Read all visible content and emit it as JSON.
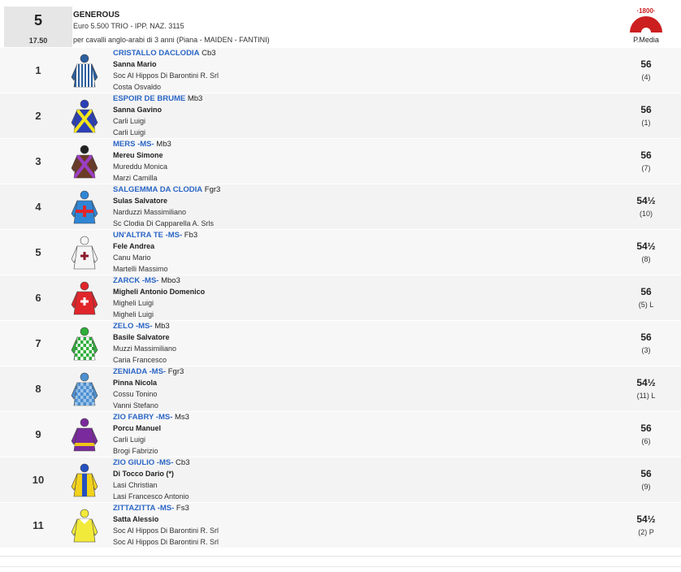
{
  "race": {
    "number": "5",
    "time": "17.50",
    "name": "GENEROUS",
    "prize": "Euro 5.500 TRIO - IPP. NAZ. 3115",
    "conditions": "per cavalli anglo-arabi di 3 anni (Piana -  MAIDEN  - FANTINI)",
    "logo_text": "·1800·",
    "pmedia_label": "P.Media"
  },
  "colors": {
    "horse_name": "#2b66c6",
    "row_bg": "#f7f7f7",
    "race_box_bg": "#e6e6e6",
    "logo_red": "#cc1f1f"
  },
  "runners": [
    {
      "num": "1",
      "horse": "CRISTALLO DACLODIA",
      "suffix": " Cb3",
      "jockey": "Sanna Mario",
      "trainer": "Soc Al Hippos Di Barontini R. Srl",
      "owner": "Costa Osvaldo",
      "weight": "56",
      "draw": "(4)",
      "silk": "blue-white-stripes",
      "silk_body": "#2c5f9e",
      "silk_alt": "#ffffff",
      "silk_cap": "#2c5f9e"
    },
    {
      "num": "2",
      "horse": "ESPOIR DE BRUME",
      "suffix": " Mb3",
      "jockey": "Sanna Gavino",
      "trainer": "Carli Luigi",
      "owner": "Carli Luigi",
      "weight": "56",
      "draw": "(1)",
      "silk": "blue-yellow-cross",
      "silk_body": "#2b3fb8",
      "silk_alt": "#f2e41c",
      "silk_cap": "#2b3fb8"
    },
    {
      "num": "3",
      "horse": "MERS -MS-",
      "suffix": " Mb3",
      "jockey": "Mereu Simone",
      "trainer": "Mureddu Monica",
      "owner": "Marzi Camilla",
      "weight": "56",
      "draw": "(7)",
      "silk": "brown-purple-cross",
      "silk_body": "#6b3b26",
      "silk_alt": "#9b3fc4",
      "silk_cap": "#222222"
    },
    {
      "num": "4",
      "horse": "SALGEMMA DA CLODIA",
      "suffix": " Fgr3",
      "jockey": "Sulas Salvatore",
      "trainer": "Narduzzi Massimiliano",
      "owner": "Sc Clodia Di Capparella A. Srls",
      "weight": "54½",
      "draw": "(10)",
      "silk": "lightblue-red-cross",
      "silk_body": "#2f86d6",
      "silk_alt": "#e0262b",
      "silk_cap": "#2f86d6"
    },
    {
      "num": "5",
      "horse": "UN'ALTRA TE -MS-",
      "suffix": " Fb3",
      "jockey": "Fele Andrea",
      "trainer": "Canu Mario",
      "owner": "Martelli Massimo",
      "weight": "54½",
      "draw": "(8)",
      "silk": "white-maroon-cross",
      "silk_body": "#f5f5f5",
      "silk_alt": "#8a1c2b",
      "silk_cap": "#f5f5f5"
    },
    {
      "num": "6",
      "horse": "ZARCK -MS-",
      "suffix": " Mbo3",
      "jockey": "Migheli Antonio Domenico",
      "trainer": "Migheli Luigi",
      "owner": "Migheli Luigi",
      "weight": "56",
      "draw": "(5) L",
      "silk": "red-white-cross",
      "silk_body": "#e0262b",
      "silk_alt": "#ffffff",
      "silk_cap": "#e0262b"
    },
    {
      "num": "7",
      "horse": "ZELO -MS-",
      "suffix": " Mb3",
      "jockey": "Basile Salvatore",
      "trainer": "Muzzi Massimiliano",
      "owner": "Caria Francesco",
      "weight": "56",
      "draw": "(3)",
      "silk": "green-check",
      "silk_body": "#2fae3a",
      "silk_alt": "#ffffff",
      "silk_cap": "#2fae3a"
    },
    {
      "num": "8",
      "horse": "ZENIADA -MS-",
      "suffix": " Fgr3",
      "jockey": "Pinna Nicola",
      "trainer": "Cossu Tonino",
      "owner": "Vanni Stefano",
      "weight": "54½",
      "draw": "(11) L",
      "silk": "lightblue-check",
      "silk_body": "#4d8fd0",
      "silk_alt": "#9cc4ea",
      "silk_cap": "#4d8fd0"
    },
    {
      "num": "9",
      "horse": "ZIO FABRY -MS-",
      "suffix": " Ms3",
      "jockey": "Porcu Manuel",
      "trainer": "Carli Luigi",
      "owner": "Brogi Fabrizio",
      "weight": "56",
      "draw": "(6)",
      "silk": "purple-yellow",
      "silk_body": "#7a2a9c",
      "silk_alt": "#f0c419",
      "silk_cap": "#7a2a9c"
    },
    {
      "num": "10",
      "horse": "ZIO GIULIO -MS-",
      "suffix": " Cb3",
      "jockey": "Di Tocco Dario (*)",
      "trainer": "Lasi Christian",
      "owner": "Lasi Francesco Antonio",
      "weight": "56",
      "draw": "(9)",
      "silk": "yellow-blue-stripe",
      "silk_body": "#f2d21c",
      "silk_alt": "#2550c0",
      "silk_cap": "#2550c0"
    },
    {
      "num": "11",
      "horse": "ZITTAZITTA -MS-",
      "suffix": " Fs3",
      "jockey": "Satta Alessio",
      "trainer": "Soc Al Hippos Di Barontini R. Srl",
      "owner": "Soc Al Hippos Di Barontini R. Srl",
      "weight": "54½",
      "draw": "(2) P",
      "silk": "yellow-white",
      "silk_body": "#f2ea3a",
      "silk_alt": "#ffffff",
      "silk_cap": "#f2ea3a"
    }
  ]
}
